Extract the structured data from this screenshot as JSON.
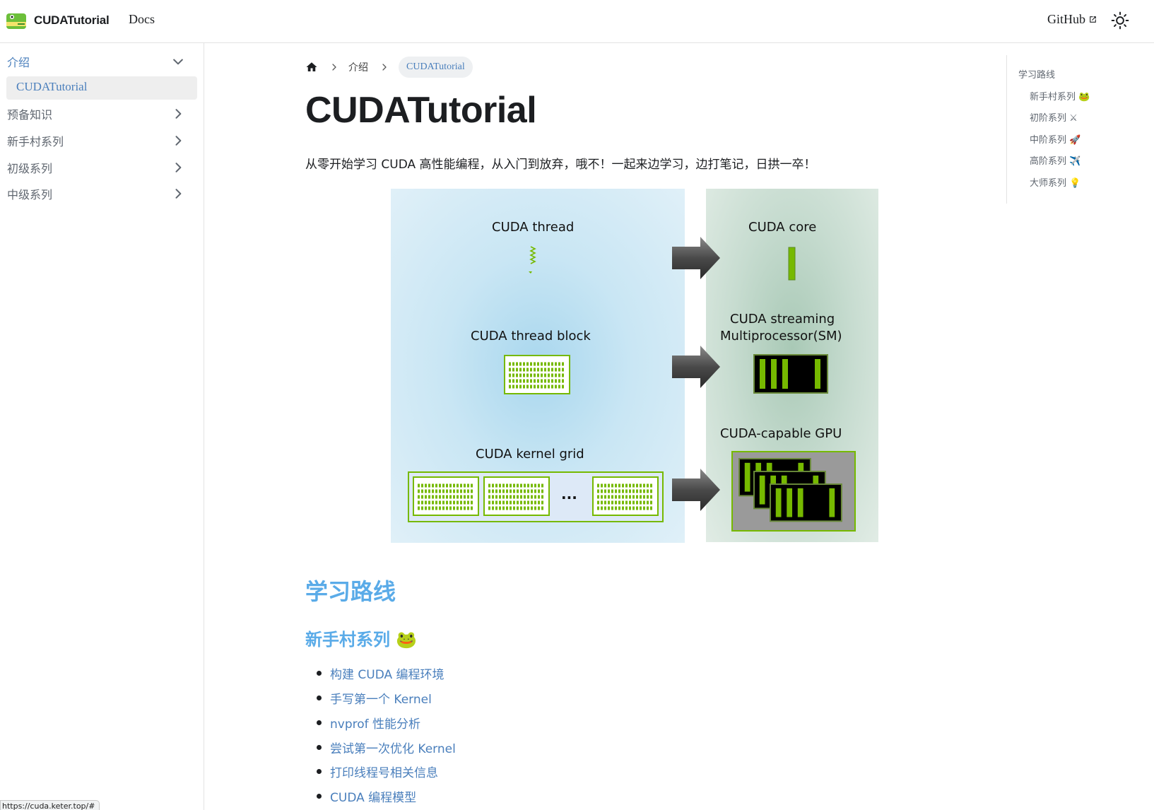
{
  "navbar": {
    "brand_title": "CUDATutorial",
    "docs_label": "Docs",
    "github_label": "GitHub",
    "icons": {
      "logo": "frog-logo-icon",
      "external": "external-link-icon",
      "theme": "sun-icon"
    }
  },
  "sidebar": {
    "items": [
      {
        "label": "介绍",
        "expanded": true
      },
      {
        "label": "CUDATutorial",
        "current": true
      },
      {
        "label": "预备知识",
        "expanded": false
      },
      {
        "label": "新手村系列",
        "expanded": false
      },
      {
        "label": "初级系列",
        "expanded": false
      },
      {
        "label": "中级系列",
        "expanded": false
      }
    ]
  },
  "breadcrumbs": {
    "items": [
      "介绍",
      "CUDATutorial"
    ]
  },
  "page": {
    "title": "CUDATutorial",
    "intro": "从零开始学习 CUDA 高性能编程，从入门到放弃，哦不！一起来边学习，边打笔记，日拱一卒！"
  },
  "figure": {
    "left": {
      "thread": "CUDA thread",
      "block": "CUDA thread block",
      "grid": "CUDA kernel grid",
      "ellipsis": "..."
    },
    "right": {
      "core": "CUDA core",
      "sm_line1": "CUDA streaming",
      "sm_line2": "Multiprocessor(SM)",
      "gpu": "CUDA-capable GPU"
    },
    "colors": {
      "green": "#76b900",
      "left_bg": "#c9e6f4",
      "right_bg": "#c7dcd0",
      "arrow": "#555555"
    }
  },
  "toc": {
    "items": [
      {
        "label": "学习路线",
        "level": 2
      },
      {
        "label": "新手村系列 🐸",
        "level": 3
      },
      {
        "label": "初阶系列 ⚔",
        "level": 3
      },
      {
        "label": "中阶系列 🚀",
        "level": 3
      },
      {
        "label": "高阶系列 ✈️",
        "level": 3
      },
      {
        "label": "大师系列 💡",
        "level": 3
      }
    ]
  },
  "content": {
    "h2": "学习路线",
    "h3": "新手村系列 🐸",
    "list": [
      "构建 CUDA 编程环境",
      "手写第一个 Kernel",
      "nvprof 性能分析",
      "尝试第一次优化 Kernel",
      "打印线程号相关信息",
      "CUDA 编程模型"
    ]
  },
  "status_bar": {
    "url": "https://cuda.keter.top/#"
  }
}
